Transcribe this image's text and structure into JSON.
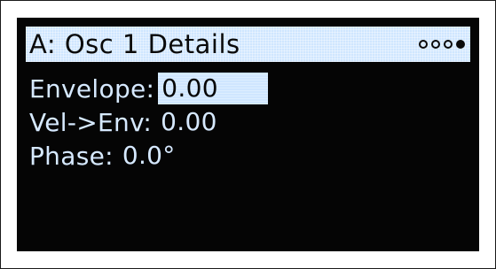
{
  "header": {
    "title": "A: Osc 1 Details",
    "page_count": 4,
    "active_page": 4
  },
  "params": [
    {
      "label": "Envelope:",
      "value": "0.00",
      "selected": true
    },
    {
      "label": "Vel->Env:",
      "value": "0.00",
      "selected": false
    },
    {
      "label": "Phase:",
      "value": "0.0°",
      "selected": false
    }
  ],
  "colors": {
    "screen_bg": "#050505",
    "text": "#d6e9ff",
    "highlight": "#cfe6ff"
  }
}
